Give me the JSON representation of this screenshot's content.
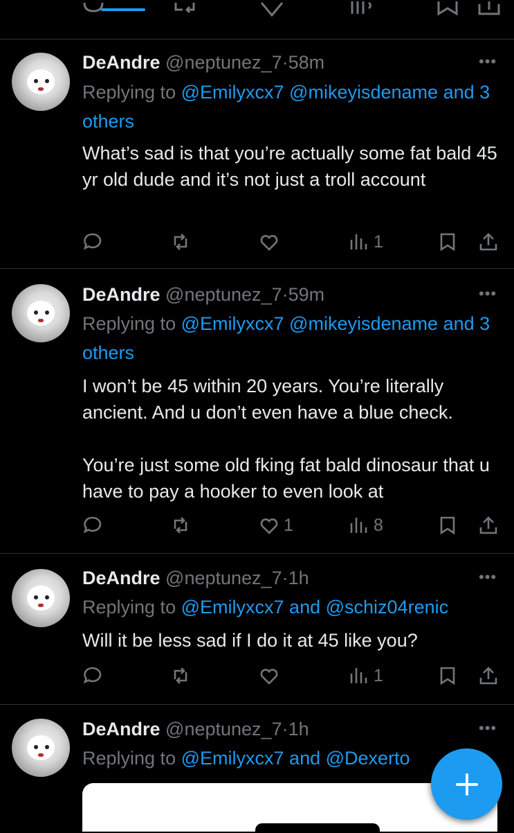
{
  "app": {
    "accent": "#1d9bf0",
    "background": "#000000",
    "muted": "#71767b"
  },
  "tweets": [
    {
      "name": "DeAndre",
      "handle": "@neptunez_7",
      "separator": "·",
      "time": "58m",
      "replying_prefix": "Replying to",
      "mention1": "@Emilyxcx7",
      "mention2": "@mikeyisdename",
      "conjunction": "and",
      "others": "3 others",
      "text": "What’s sad is that you’re actually some fat bald 45 yr old dude and it’s not just a troll account",
      "likes": "",
      "views": "1"
    },
    {
      "name": "DeAndre",
      "handle": "@neptunez_7",
      "separator": "·",
      "time": "59m",
      "replying_prefix": "Replying to",
      "mention1": "@Emilyxcx7",
      "mention2": "@mikeyisdename",
      "conjunction": "and",
      "others": "3 others",
      "text": "I won’t be 45 within 20 years. You’re literally ancient. And u don’t even have a blue check.\n\nYou’re just some old fking fat bald dinosaur that u have to pay a hooker to even look at",
      "likes": "1",
      "views": "8"
    },
    {
      "name": "DeAndre",
      "handle": "@neptunez_7",
      "separator": "·",
      "time": "1h",
      "replying_prefix": "Replying to",
      "mention1": "@Emilyxcx7",
      "conjunction": "and",
      "mention2": "@schiz04renic",
      "text": "Will it be less sad if I do it at 45 like you?",
      "likes": "",
      "views": "1"
    },
    {
      "name": "DeAndre",
      "handle": "@neptunez_7",
      "separator": "·",
      "time": "1h",
      "replying_prefix": "Replying to",
      "mention1": "@Emilyxcx7",
      "conjunction": "and",
      "mention2": "@Dexerto"
    }
  ],
  "icons": {
    "reply": "reply-icon",
    "repost": "repost-icon",
    "like": "like-icon",
    "views": "views-icon",
    "bookmark": "bookmark-icon",
    "share": "share-icon",
    "more": "more-icon",
    "compose": "plus-icon"
  }
}
